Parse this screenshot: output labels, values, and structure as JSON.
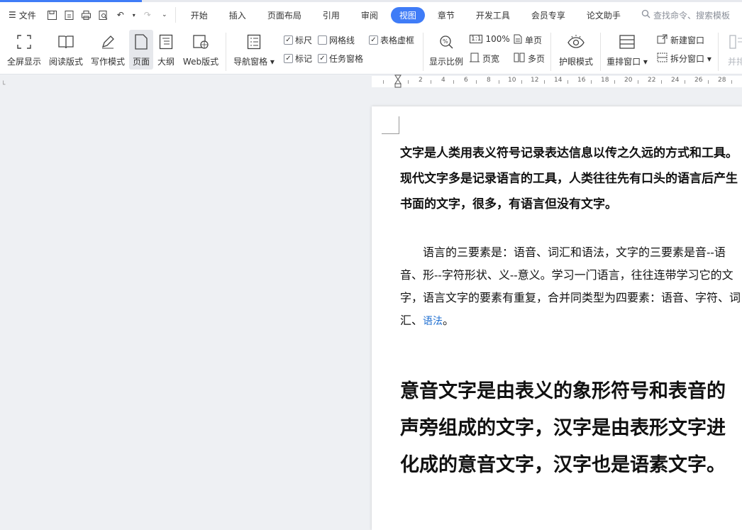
{
  "menu": {
    "label": "文件"
  },
  "tabs": [
    {
      "label": "开始"
    },
    {
      "label": "插入"
    },
    {
      "label": "页面布局"
    },
    {
      "label": "引用"
    },
    {
      "label": "审阅"
    },
    {
      "label": "视图"
    },
    {
      "label": "章节"
    },
    {
      "label": "开发工具"
    },
    {
      "label": "会员专享"
    },
    {
      "label": "论文助手"
    }
  ],
  "search": {
    "placeholder": "查找命令、搜索模板"
  },
  "ribbon": {
    "fullscreen": "全屏显示",
    "read_mode": "阅读版式",
    "write_mode": "写作模式",
    "page": "页面",
    "outline": "大纲",
    "web": "Web版式",
    "nav_pane": "导航窗格",
    "ruler": "标尺",
    "gridlines": "网格线",
    "table_border": "表格虚框",
    "markup": "标记",
    "task_pane": "任务窗格",
    "zoom_ratio": "显示比例",
    "zoom100": "100%",
    "page_width": "页宽",
    "single_page": "单页",
    "multi_page": "多页",
    "eye_mode": "护眼模式",
    "rearrange": "重排窗口",
    "new_window": "新建窗口",
    "split_window": "拆分窗口",
    "side_by_side": "并排"
  },
  "checkboxes": {
    "ruler": true,
    "gridlines": false,
    "table_border": true,
    "markup": true,
    "task_pane": true
  },
  "ruler_marks": [
    "2",
    "4",
    "6",
    "8",
    "10",
    "12",
    "14",
    "16",
    "18",
    "20",
    "22",
    "24",
    "26",
    "28"
  ],
  "document": {
    "para1": "文字是人类用表义符号记录表达信息以传之久远的方式和工具。现代文字多是记录语言的工具，人类往往先有口头的语言后产生书面的文字，很多，有语言但没有文字。",
    "para2_text": "　　语言的三要素是：语音、词汇和语法，文字的三要素是音--语音、形--字符形状、义--意义。学习一门语言，往往连带学习它的文字，语言文字的要素有重复，合并同类型为四要素：语音、字符、词汇、",
    "para2_link": "语法",
    "para2_end": "。",
    "para3": "意音文字是由表义的象形符号和表音的声旁组成的文字，汉字是由表形文字进化成的意音文字，汉字也是语素文字。"
  },
  "colors": {
    "accent": "#3f7cf7",
    "link": "#1f6fd1"
  }
}
